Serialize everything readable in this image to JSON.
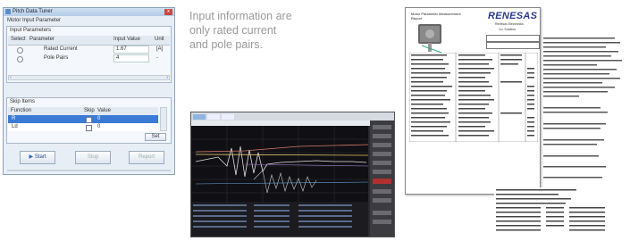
{
  "dialog": {
    "title": "Pitch Data Tuner",
    "close_glyph": "x",
    "tab_label": "Motor Input Parameter",
    "group_label": "Input Parameters",
    "columns": [
      "Select",
      "Parameter",
      "Input Value",
      "Unit"
    ],
    "rows": [
      {
        "param": "Rated Current",
        "value": "1.67",
        "unit": "[A]"
      },
      {
        "param": "Pole Pairs",
        "value": "4",
        "unit": "-"
      }
    ],
    "skip_group_label": "Skip Items",
    "skip_columns": [
      "Function",
      "Skip",
      "Value"
    ],
    "skip_rows": [
      {
        "function": "R",
        "value": "0"
      },
      {
        "function": "Ld",
        "value": "0"
      }
    ],
    "set_button": "Set",
    "start_button": "Start",
    "stop_button": "Stop",
    "report_button": "Report"
  },
  "caption": {
    "lines": [
      "Input information are",
      "only rated current",
      "and pole pairs."
    ]
  },
  "report": {
    "header_left": "Motor Parameter Measurement Report",
    "brand": "RENESAS",
    "brand_sub": "Renesas Electronics",
    "brand_sub2": "Co. Solution"
  },
  "colors": {
    "caption": "#9a9a9a",
    "brand": "#2b3990",
    "scope_bg": "#2a2a2e",
    "selected_row": "#3a7bd5"
  }
}
